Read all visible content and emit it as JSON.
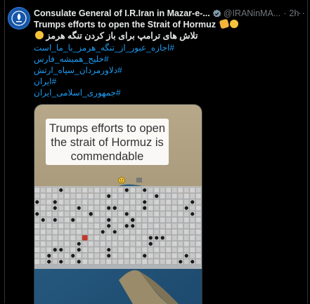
{
  "tweet": {
    "display_name": "Consulate General of I.R.Iran in Mazar-e-...",
    "handle": "@IRANinMA...",
    "time": "2h",
    "more": "···",
    "text_en": "Trumps efforts to open the Strait of Hormuz",
    "text_fa": "تلاش های ترامپ برای باز کردن تنگه هرمز",
    "hashtags": [
      "#اجازه_عبور_از_تنگه_هرمز_با_ما_است",
      "#خلیج_همیشه_فارس",
      "#دلاورمردان_سپاه_ارتش",
      "#ایران",
      "#جمهوری_اسلامی_ایران"
    ]
  },
  "media": {
    "caption": "Trumps efforts to open the strait of Hormuz is commendable"
  },
  "colors": {
    "background": "#000000",
    "text": "#e7e9ea",
    "muted": "#71767b",
    "link": "#1d9bf0",
    "verified": "#829aab",
    "avatar": "#1556a8"
  },
  "icons": [
    "verified-badge-icon",
    "more-options-icon",
    "consulate-emblem-icon",
    "clapping-hands-emoji",
    "grinning-sweat-emoji"
  ]
}
